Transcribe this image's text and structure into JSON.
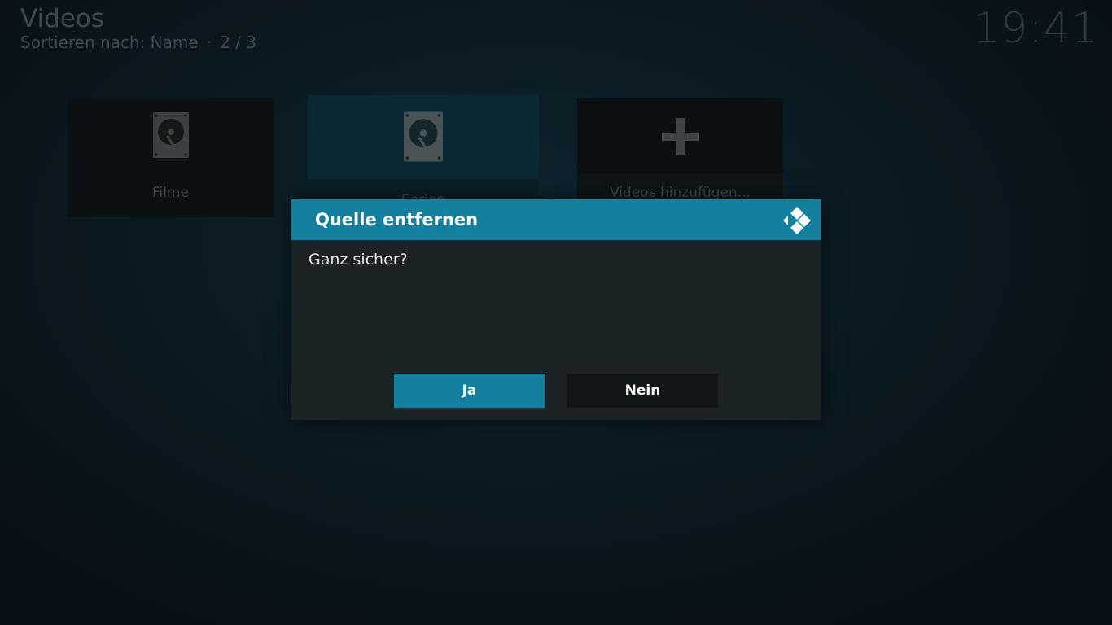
{
  "header": {
    "title": "Videos",
    "sort_label": "Sortieren nach: Name",
    "separator": "·",
    "position": "2 / 3",
    "clock": "19:41"
  },
  "tiles": [
    {
      "label": "Filme",
      "icon": "hard-drive-icon",
      "focused": false
    },
    {
      "label": "Serien",
      "icon": "hard-drive-icon",
      "focused": true
    },
    {
      "label": "Videos hinzufügen...",
      "icon": "plus-icon",
      "focused": false
    }
  ],
  "dialog": {
    "title": "Quelle entfernen",
    "logo_icon": "kodi-logo-icon",
    "message": "Ganz sicher?",
    "yes_label": "Ja",
    "no_label": "Nein"
  },
  "colors": {
    "accent": "#12809e",
    "dialog_bg": "#1c2326",
    "button_inactive": "#111619",
    "background": "#0b1b22"
  }
}
